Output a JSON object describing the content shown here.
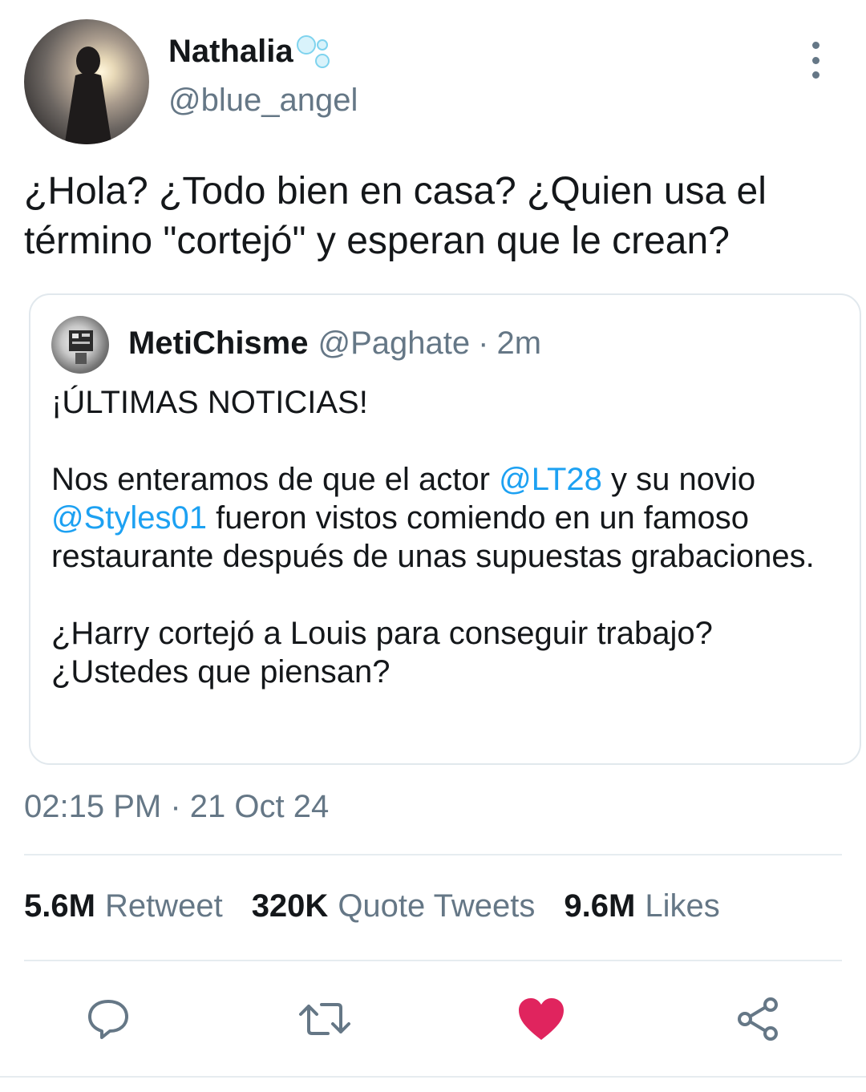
{
  "author": {
    "display_name": "Nathalia",
    "handle": "@blue_angel"
  },
  "tweet": {
    "text": "¿Hola? ¿Todo bien en casa? ¿Quien usa el término \"cortejó\" y esperan que le crean?"
  },
  "quoted_tweet": {
    "display_name": "MetiChisme",
    "handle": "@Paghate",
    "separator": "·",
    "time_ago": "2m",
    "headline": "¡ÚLTIMAS NOTICIAS!",
    "p2_text_1": "Nos enteramos de que el actor ",
    "mention_1": "@LT28",
    "p2_text_2": " y su novio ",
    "mention_2": "@Styles01",
    "p2_text_3": " fueron vistos comiendo en un famoso restaurante después de unas supuestas grabaciones.",
    "p3_line_1": "¿Harry cortejó a Louis para conseguir trabajo?",
    "p3_line_2": "¿Ustedes que piensan?"
  },
  "timestamp": "02:15 PM · 21 Oct 24",
  "stats": {
    "retweets_count": "5.6M",
    "retweets_label": "Retweet",
    "quotes_count": "320K",
    "quotes_label": "Quote Tweets",
    "likes_count": "9.6M",
    "likes_label": "Likes"
  },
  "colors": {
    "accent": "#1da1f2",
    "like": "#e0245e",
    "muted": "#657786",
    "text": "#14171a",
    "border": "#e1e8ed"
  },
  "icons": {
    "reply": "reply-icon",
    "retweet": "retweet-icon",
    "like": "heart-icon",
    "share": "share-icon",
    "more": "more-vertical-icon"
  }
}
